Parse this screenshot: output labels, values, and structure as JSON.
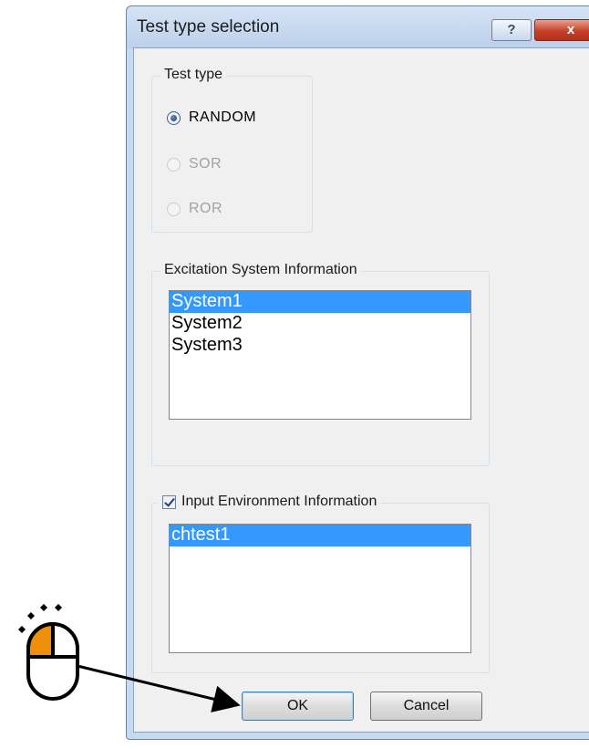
{
  "window": {
    "title": "Test type selection",
    "help_label": "?",
    "close_label": "x"
  },
  "test_type": {
    "legend": "Test type",
    "options": [
      {
        "label": "RANDOM",
        "checked": true,
        "enabled": true
      },
      {
        "label": "SOR",
        "checked": false,
        "enabled": false
      },
      {
        "label": "ROR",
        "checked": false,
        "enabled": false
      }
    ]
  },
  "excitation": {
    "legend": "Excitation System Information",
    "items": [
      "System1",
      "System2",
      "System3"
    ],
    "selected": "System1"
  },
  "environment": {
    "legend": "Input Environment Information",
    "checked": true,
    "items": [
      "chtest1"
    ],
    "selected": "chtest1"
  },
  "buttons": {
    "ok": "OK",
    "cancel": "Cancel"
  },
  "annotation": {
    "icon": "mouse-click-icon",
    "accent_color": "#f0900a"
  }
}
